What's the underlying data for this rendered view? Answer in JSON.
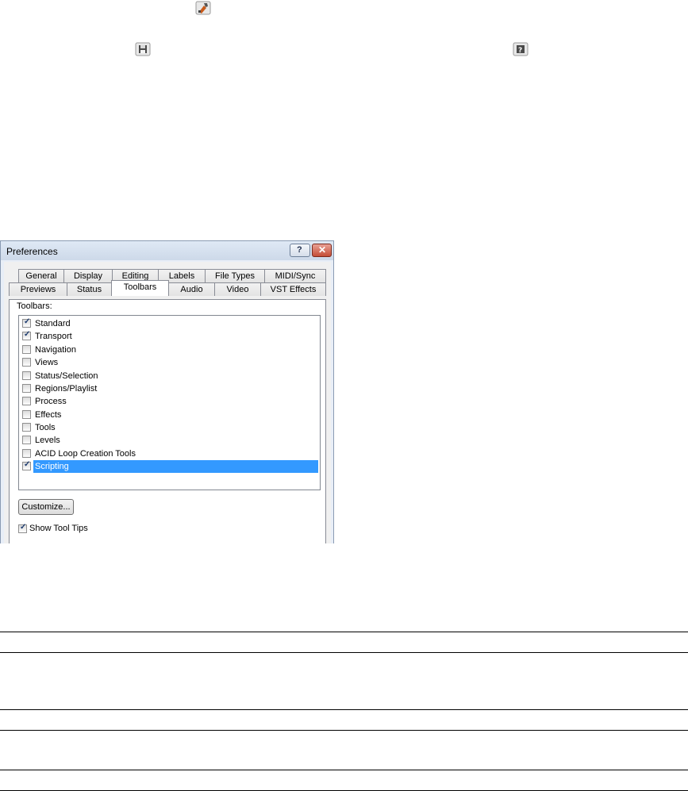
{
  "top_icons": {
    "tools": "tools-icon",
    "save": "save-icon",
    "help": "help-icon"
  },
  "dialog": {
    "title": "Preferences",
    "help_button": "?",
    "close_button": "✕",
    "tabs_row1": [
      "General",
      "Display",
      "Editing",
      "Labels",
      "File Types",
      "MIDI/Sync"
    ],
    "tabs_row2": [
      "Previews",
      "Status",
      "Toolbars",
      "Audio",
      "Video",
      "VST Effects"
    ],
    "selected_tab": "Toolbars",
    "toolbars_label": "Toolbars:",
    "toolbars": [
      {
        "label": "Standard",
        "checked": true
      },
      {
        "label": "Transport",
        "checked": true
      },
      {
        "label": "Navigation",
        "checked": false
      },
      {
        "label": "Views",
        "checked": false
      },
      {
        "label": "Status/Selection",
        "checked": false
      },
      {
        "label": "Regions/Playlist",
        "checked": false
      },
      {
        "label": "Process",
        "checked": false
      },
      {
        "label": "Effects",
        "checked": false
      },
      {
        "label": "Tools",
        "checked": false
      },
      {
        "label": "Levels",
        "checked": false
      },
      {
        "label": "ACID Loop Creation Tools",
        "checked": false
      },
      {
        "label": "Scripting",
        "checked": true,
        "selected": true
      }
    ],
    "customize_button": "Customize...",
    "show_tool_tips": {
      "label": "Show Tool Tips",
      "checked": true
    }
  },
  "colors": {
    "selection": "#3399ff",
    "dialog_border": "#8a9bb3",
    "close_button": "#c44d36"
  }
}
